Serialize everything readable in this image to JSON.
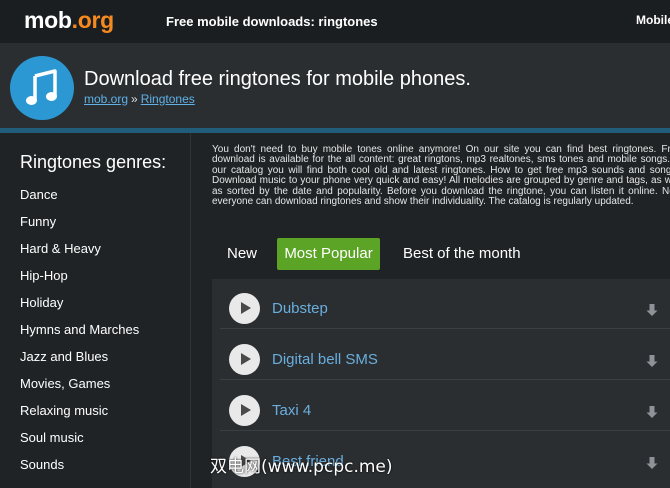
{
  "topbar": {
    "logo_main": "mob",
    "logo_dot": ".org",
    "tagline": "Free mobile downloads: ringtones",
    "right_link": "Mobile"
  },
  "header": {
    "title": "Download free ringtones for mobile phones.",
    "breadcrumb_home": "mob.org",
    "breadcrumb_sep": "»",
    "breadcrumb_current": "Ringtones",
    "icon": "music-note-icon"
  },
  "sidebar": {
    "title": "Ringtones genres:",
    "genres": [
      "Dance",
      "Funny",
      "Hard & Heavy",
      "Hip-Hop",
      "Holiday",
      "Hymns and Marches",
      "Jazz and Blues",
      "Movies, Games",
      "Relaxing music",
      "Soul music",
      "Sounds"
    ]
  },
  "intro": "You don't need to buy mobile tones online anymore! On our site you can find best ringtones. Free download is available for the all content: great ringtons, mp3 realtones, sms tones and mobile songs. In our catalog you will find both cool old and latest ringtones. How to get free mp3 sounds and songs? Download music to your phone very quick and easy! All melodies are grouped by genre and tags, as well as sorted by the date and popularity. Before you download the ringtone, you can listen it online. Now everyone can download ringtones and show their individuality. The catalog is regularly updated.",
  "tabs": [
    "New",
    "Most Popular",
    "Best of the month"
  ],
  "active_tab": "Most Popular",
  "tracks": [
    "Dubstep",
    "Digital bell SMS",
    "Taxi 4",
    "Best friend"
  ],
  "watermark": "双电网(www.pcpc.me)",
  "colors": {
    "brand_orange": "#f6891f",
    "accent_blue": "#2b98d4",
    "active_tab_green": "#5ca425",
    "link_blue": "#6aaede"
  }
}
